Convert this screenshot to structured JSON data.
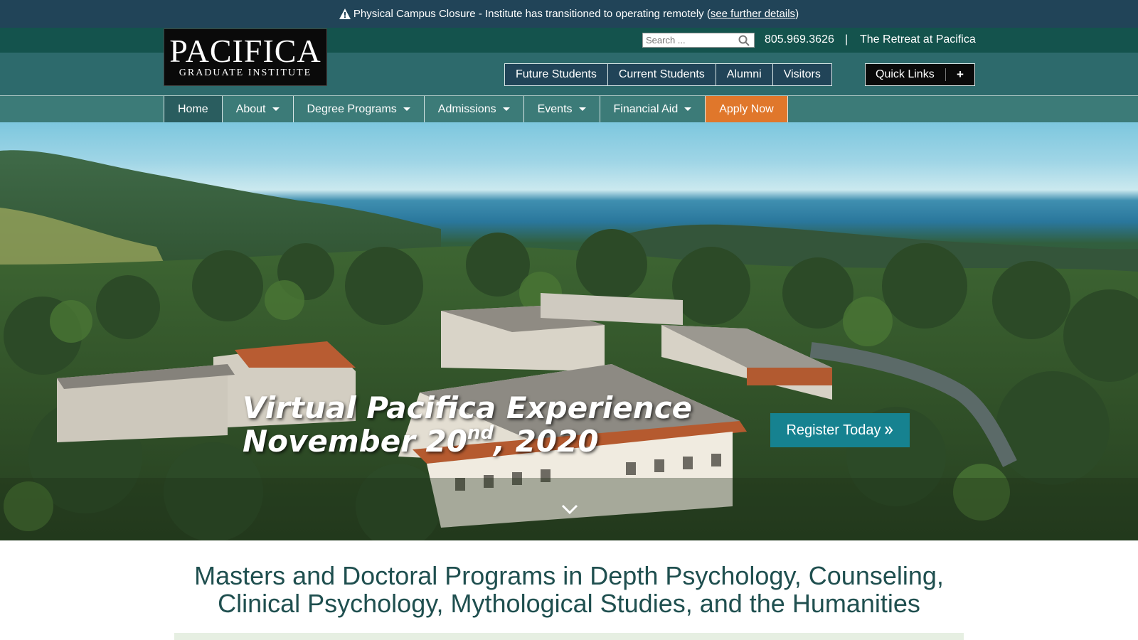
{
  "alert": {
    "text": "Physical Campus Closure - Institute has transitioned to operating remotely (",
    "link": "see further details",
    "suffix": ")"
  },
  "header": {
    "logo": {
      "title": "PACIFICA",
      "subtitle": "GRADUATE INSTITUTE"
    },
    "search": {
      "placeholder": "Search ..."
    },
    "phone": "805.969.3626",
    "separator": "|",
    "retreat": "The Retreat at Pacifica",
    "audience": [
      "Future Students",
      "Current Students",
      "Alumni",
      "Visitors"
    ],
    "quick_links": {
      "label": "Quick Links",
      "plus": "+"
    }
  },
  "nav": {
    "items": [
      {
        "label": "Home",
        "dropdown": false
      },
      {
        "label": "About",
        "dropdown": true
      },
      {
        "label": "Degree Programs",
        "dropdown": true
      },
      {
        "label": "Admissions",
        "dropdown": true
      },
      {
        "label": "Events",
        "dropdown": true
      },
      {
        "label": "Financial Aid",
        "dropdown": true
      }
    ],
    "apply": "Apply Now"
  },
  "hero": {
    "line1": "Virtual Pacifica Experience",
    "line2_main": "November 20",
    "line2_sup": "nd",
    "line2_end": ", 2020",
    "register": "Register Today",
    "register_icon": "double-chevron-right"
  },
  "intro": {
    "line1": "Masters and Doctoral Programs in Depth Psychology, Counseling,",
    "line2": "Clinical Psychology, Mythological Studies, and the Humanities"
  },
  "colors": {
    "alert_bg": "#214458",
    "header_bg": "#2d6a6c",
    "topstrip_bg": "#14534d",
    "apply_bg": "#e0772b",
    "register_bg": "#168290",
    "intro_text": "#1f4f4f"
  }
}
